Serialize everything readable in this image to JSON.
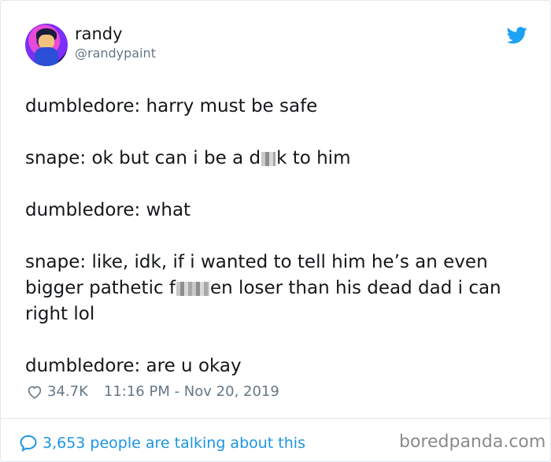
{
  "author": {
    "name": "randy",
    "handle": "@randypaint",
    "avatar_icon": "user-avatar"
  },
  "tweet": {
    "line1": "dumbledore: harry must be safe",
    "line2_before": "snape: ok but can i be a d",
    "line2_after": "k to him",
    "line3": "dumbledore: what",
    "line4_before": "snape: like, idk, if i wanted to tell him he’s an even bigger pathetic f",
    "line4_after": "en loser than his dead dad i can right lol",
    "line5": "dumbledore: are u okay"
  },
  "meta": {
    "likes": "34.7K",
    "timestamp": "11:16 PM - Nov 20, 2019"
  },
  "footer": {
    "talking": "3,653 people are talking about this",
    "watermark": "boredpanda.com"
  },
  "colors": {
    "link": "#1b95e0",
    "muted": "#657786",
    "twitter_blue": "#1da1f2"
  }
}
